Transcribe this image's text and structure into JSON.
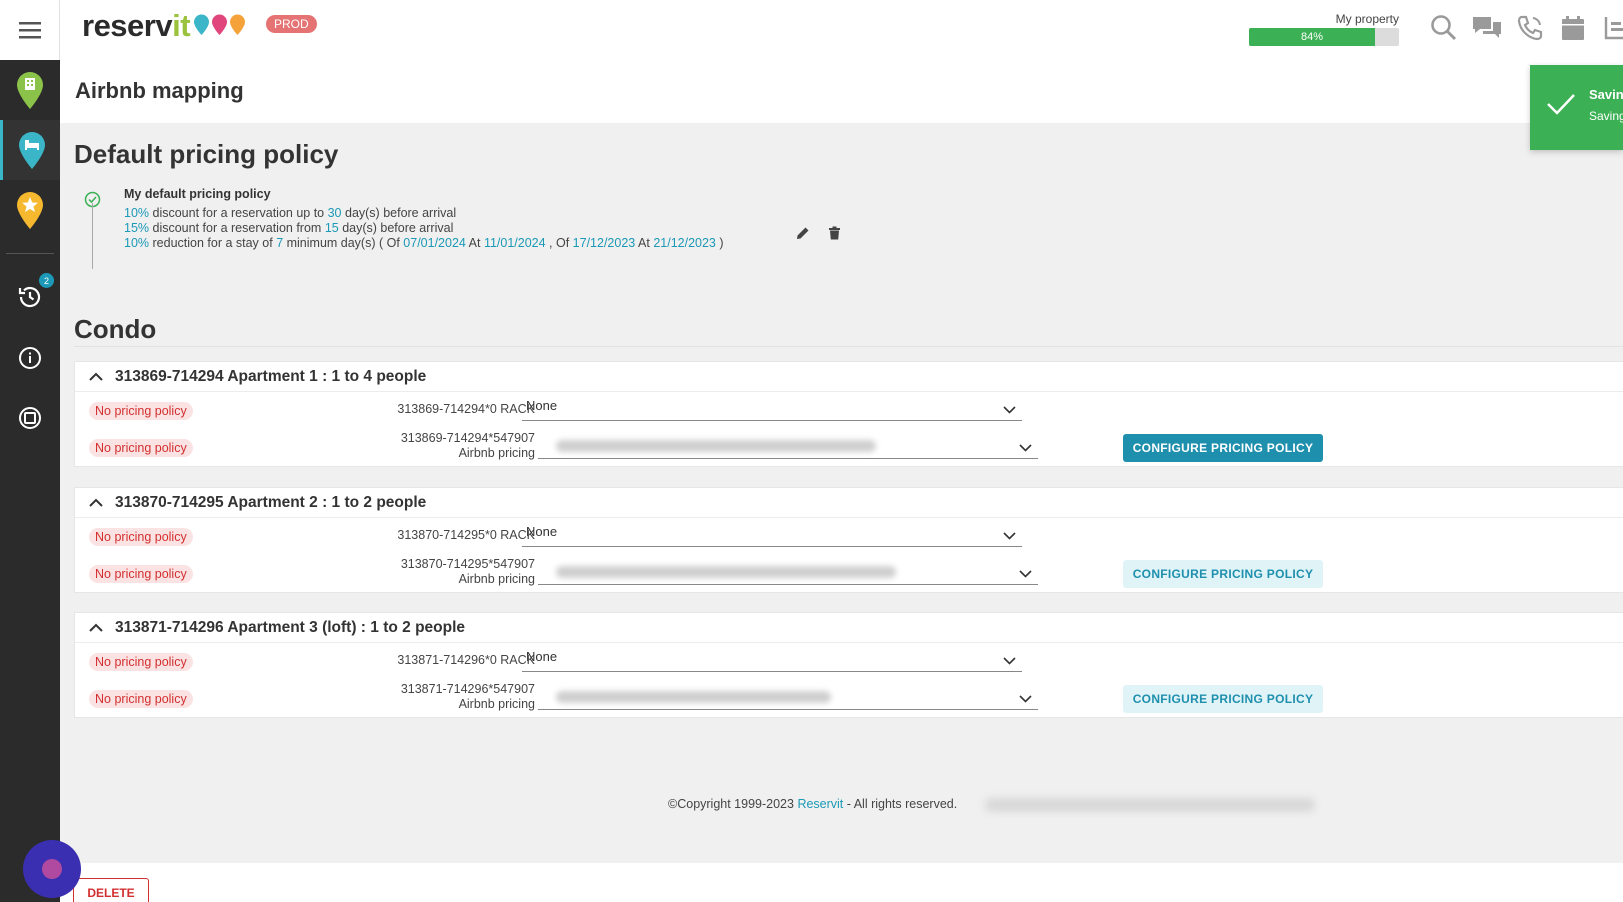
{
  "header": {
    "brand_main": "reserv",
    "brand_accent": "it",
    "env_badge": "PROD",
    "property_label": "My property",
    "completion": "84%",
    "completion_pct": 84
  },
  "toast": {
    "title": "Savinc",
    "subtitle": "Saving"
  },
  "sidebar": {
    "history_badge": "2"
  },
  "page": {
    "title": "Airbnb mapping"
  },
  "default_policy": {
    "section_title": "Default pricing policy",
    "name": "My default pricing policy",
    "line1": {
      "pct": "10%",
      "text_a": " discount for a reservation up to ",
      "days": "30",
      "text_b": " day(s) before arrival"
    },
    "line2": {
      "pct": "15%",
      "text_a": " discount for a reservation from ",
      "days": "15",
      "text_b": " day(s) before arrival"
    },
    "line3": {
      "pct": "10%",
      "text_a": " reduction for a stay of ",
      "days": "7",
      "text_b": " minimum day(s) ( Of ",
      "d1": "07/01/2024",
      "at1": " At ",
      "d2": "11/01/2024",
      "sep": " , Of ",
      "d3": "17/12/2023",
      "at2": " At ",
      "d4": "21/12/2023",
      "end": " )"
    }
  },
  "condo": {
    "section_title": "Condo",
    "no_policy": "No pricing policy",
    "none_option": "None",
    "configure_label": "CONFIGURE PRICING POLICY",
    "rooms": [
      {
        "title": "313869-714294 Apartment 1 : 1 to 4 people",
        "rack_code": "313869-714294*0 RACK",
        "airbnb_code": "313869-714294*547907",
        "airbnb_label": "Airbnb pricing"
      },
      {
        "title": "313870-714295 Apartment 2 : 1 to 2 people",
        "rack_code": "313870-714295*0 RACK",
        "airbnb_code": "313870-714295*547907",
        "airbnb_label": "Airbnb pricing"
      },
      {
        "title": "313871-714296 Apartment 3 (loft) : 1 to 2 people",
        "rack_code": "313871-714296*0 RACK",
        "airbnb_code": "313871-714296*547907",
        "airbnb_label": "Airbnb pricing"
      }
    ]
  },
  "footer": {
    "copyright_a": "©Copyright 1999-2023 ",
    "link": "Reservit",
    "copyright_b": " - All rights reserved."
  },
  "actions": {
    "delete_label": "DELETE"
  },
  "colors": {
    "accent": "#1b99b6",
    "success": "#3cb054",
    "danger": "#d32f2f",
    "sidebar": "#2b2b2b"
  }
}
